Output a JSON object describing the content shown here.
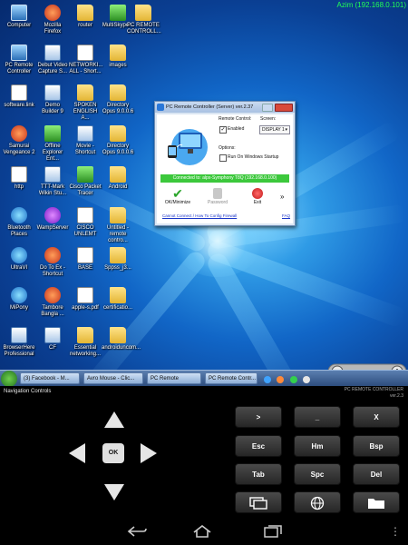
{
  "status_bar": {
    "connection": "Azim (192.168.0.101)"
  },
  "desktop_icons": [
    {
      "label": "Computer",
      "kind": "pc"
    },
    {
      "label": "Mozilla Firefox",
      "kind": "red"
    },
    {
      "label": "router",
      "kind": "folder"
    },
    {
      "label": "MultiSkype...",
      "kind": "green"
    },
    {
      "label": "PC REMOTE CONTROLL...",
      "kind": "folder"
    },
    {
      "label": "PC Remote Controller",
      "kind": "pc"
    },
    {
      "label": "Debut Video Capture S...",
      "kind": "app"
    },
    {
      "label": "NETWORKI... ALL - Short...",
      "kind": "doc"
    },
    {
      "label": "images",
      "kind": "folder"
    },
    {
      "label": "software.link",
      "kind": "doc"
    },
    {
      "label": "Demo Builder 9",
      "kind": "app"
    },
    {
      "label": "SPOKEN ENGLISH A...",
      "kind": "folder"
    },
    {
      "label": "Directory Opus 9.0.0.6",
      "kind": "folder"
    },
    {
      "label": "Samurai Vengeance 2",
      "kind": "red"
    },
    {
      "label": "Offline Explorer Ent...",
      "kind": "green"
    },
    {
      "label": "Movie - Shortcut",
      "kind": "app"
    },
    {
      "label": "Directory Opus 9.0.0.6",
      "kind": "folder"
    },
    {
      "label": "http",
      "kind": "doc"
    },
    {
      "label": "TTT-Mark Wikin Stu...",
      "kind": "app"
    },
    {
      "label": "Cisco Packet Tracer",
      "kind": "green"
    },
    {
      "label": "Android",
      "kind": "folder"
    },
    {
      "label": "Bluetooth Places",
      "kind": "blue"
    },
    {
      "label": "WampServer",
      "kind": "purple"
    },
    {
      "label": "CISCO UNLEMT",
      "kind": "doc"
    },
    {
      "label": "Untitled - remote contro...",
      "kind": "folder"
    },
    {
      "label": "UltraVI",
      "kind": "blue"
    },
    {
      "label": "Do To Ex - Shortcut",
      "kind": "red"
    },
    {
      "label": "BASE",
      "kind": "doc"
    },
    {
      "label": "Sppss_j3...",
      "kind": "folder"
    },
    {
      "label": "MiPony",
      "kind": "blue"
    },
    {
      "label": "Tambore Bangla ...",
      "kind": "red"
    },
    {
      "label": "apple-s.pdf",
      "kind": "doc"
    },
    {
      "label": "certificatio...",
      "kind": "folder"
    },
    {
      "label": "BrowserHere Professional",
      "kind": "app"
    },
    {
      "label": "CF",
      "kind": "app"
    },
    {
      "label": "Essential networking...",
      "kind": "folder"
    },
    {
      "label": "androiduncom...",
      "kind": "folder"
    }
  ],
  "window": {
    "title": "PC Remote Controller (Server) ver.2.37",
    "remote_control_label": "Remote Control:",
    "enabled_label": "Enabled",
    "screen_label": "Screen:",
    "screen_value": "DISPLAY 1",
    "options_label": "Options:",
    "startup_label": "Run On Windows Startup",
    "connected_text": "Connected to: alpx-Symphony T8Q (192.168.0.100)",
    "ok_label": "OK/Minimize",
    "password_label": "Password",
    "exit_label": "Exit",
    "more_label": "»",
    "config_link": "Cannot Connect / How To Config Firewall",
    "faq_link": "FAQ"
  },
  "taskbar": {
    "items": [
      "(3) Facebook - M...",
      "Avro Mouse - Clic...",
      "PC Remote",
      "PC Remote Contr..."
    ]
  },
  "controller": {
    "nav_label": "Navigation Controls",
    "brand": "PC REMOTE CONTROLLER",
    "version": "ver.2.3",
    "ok_label": "OK",
    "keys": [
      ">",
      "_",
      "X",
      "Esc",
      "Hm",
      "Bsp",
      "Tab",
      "Spc",
      "Del"
    ]
  },
  "colors": {
    "connected_green": "#3cc83c",
    "ip_green": "#22ff55",
    "key_background": "#333333"
  }
}
